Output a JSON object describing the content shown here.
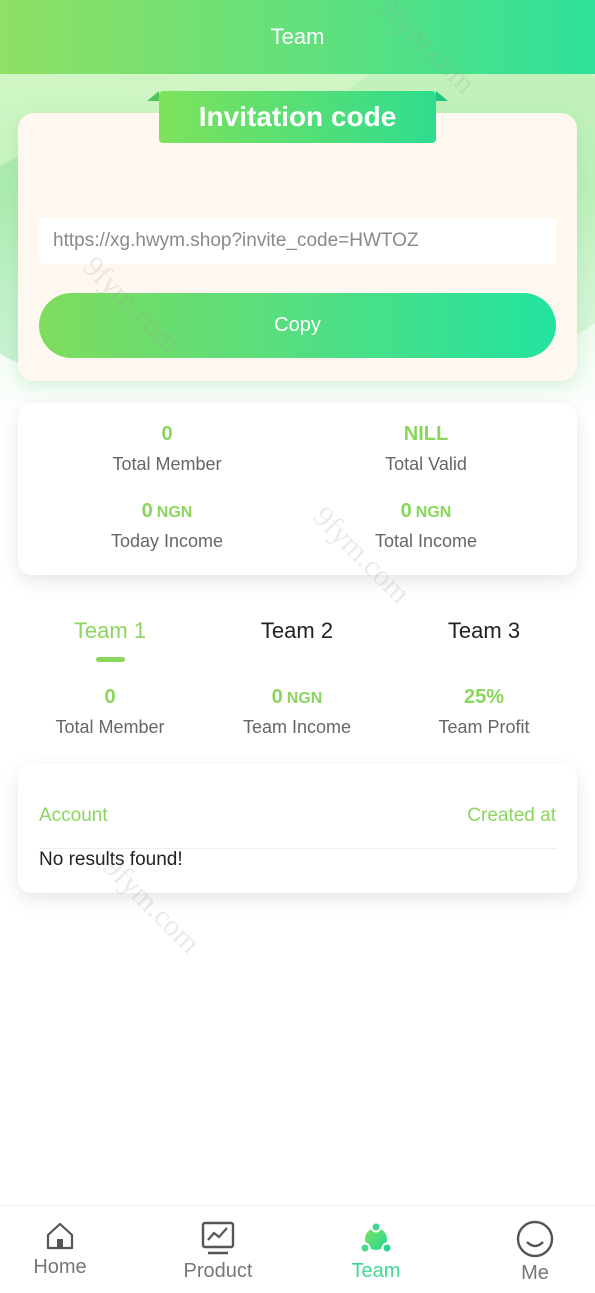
{
  "header": {
    "title": "Team"
  },
  "invite": {
    "title": "Invitation code",
    "link": "https://xg.hwym.shop?invite_code=HWTOZ",
    "copy_label": "Copy"
  },
  "stats": {
    "total_member": {
      "value": "0",
      "label": "Total Member"
    },
    "total_valid": {
      "value": "NILL",
      "label": "Total Valid"
    },
    "today_income": {
      "value": "0",
      "unit": "NGN",
      "label": "Today Income"
    },
    "total_income": {
      "value": "0",
      "unit": "NGN",
      "label": "Total Income"
    }
  },
  "tabs": [
    {
      "label": "Team 1",
      "active": true
    },
    {
      "label": "Team 2",
      "active": false
    },
    {
      "label": "Team 3",
      "active": false
    }
  ],
  "team_stats": {
    "total_member": {
      "value": "0",
      "label": "Total Member"
    },
    "team_income": {
      "value": "0",
      "unit": "NGN",
      "label": "Team Income"
    },
    "team_profit": {
      "value": "25%",
      "label": "Team Profit"
    }
  },
  "table": {
    "col_account": "Account",
    "col_created": "Created at",
    "empty_text": "No results found!"
  },
  "tabbar": [
    {
      "label": "Home",
      "icon": "home-icon"
    },
    {
      "label": "Product",
      "icon": "chart-icon"
    },
    {
      "label": "Team",
      "icon": "team-icon",
      "active": true
    },
    {
      "label": "Me",
      "icon": "smile-icon"
    }
  ],
  "watermark": "9fym.com",
  "colors": {
    "accent": "#8ad65c",
    "gradient_start": "#8fe063",
    "gradient_end": "#2ee19a",
    "tab_active": "#3fd98f"
  }
}
